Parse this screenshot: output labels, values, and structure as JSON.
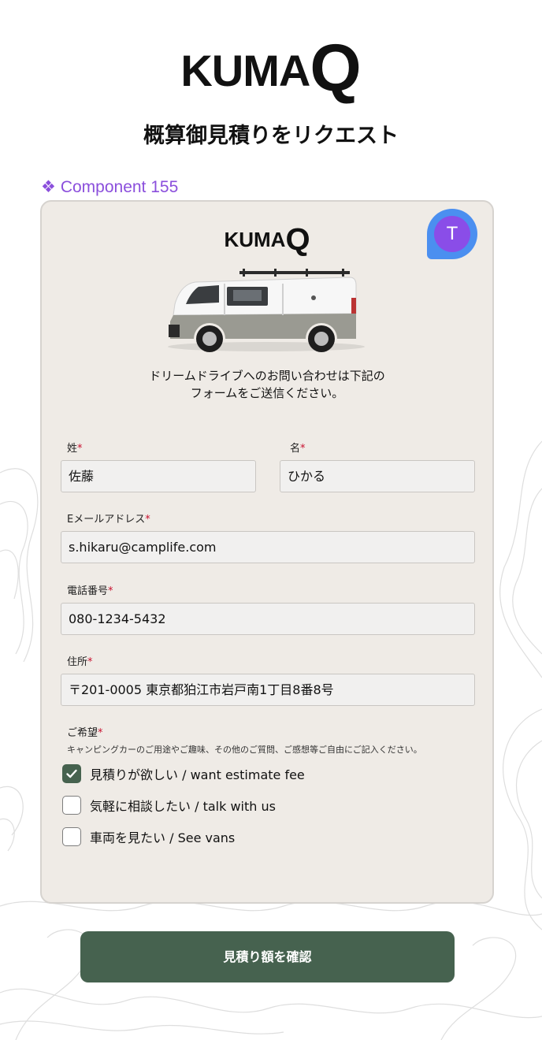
{
  "brand": {
    "logo_main": "KUMA",
    "logo_q": "Q"
  },
  "page": {
    "title": "概算御見積りをリクエスト"
  },
  "component": {
    "label": "Component 155",
    "diamond": "❖"
  },
  "card": {
    "logo_main": "KUMA",
    "logo_q": "Q",
    "avatar_initial": "T",
    "intro_line1": "ドリームドライブへのお問い合わせは下記の",
    "intro_line2": "フォームをご送信ください。"
  },
  "form": {
    "last_name": {
      "label": "姓",
      "value": "佐藤"
    },
    "first_name": {
      "label": "名",
      "value": "ひかる"
    },
    "email": {
      "label": "Eメールアドレス",
      "value": "s.hikaru@camplife.com"
    },
    "phone": {
      "label": "電話番号",
      "value": "080-1234-5432"
    },
    "address": {
      "label": "住所",
      "value": "〒201-0005 東京都狛江市岩戸南1丁目8番8号"
    },
    "wish": {
      "label": "ご希望",
      "hint": "キャンピングカーのご用途やご趣味、その他のご質問、ご感想等ご自由にご記入ください。",
      "options": [
        {
          "label": "見積りが欲しい / want estimate fee",
          "checked": true
        },
        {
          "label": "気軽に相談したい / talk with us",
          "checked": false
        },
        {
          "label": "車両を見たい / See vans",
          "checked": false
        }
      ]
    },
    "required_mark": "*"
  },
  "submit": {
    "label": "見積り額を確認"
  },
  "colors": {
    "accent_green": "#46624f",
    "component_purple": "#8b4fdc",
    "avatar_purple": "#8a4de8",
    "avatar_blue": "#4b8ff0",
    "required_red": "#c8102e"
  }
}
